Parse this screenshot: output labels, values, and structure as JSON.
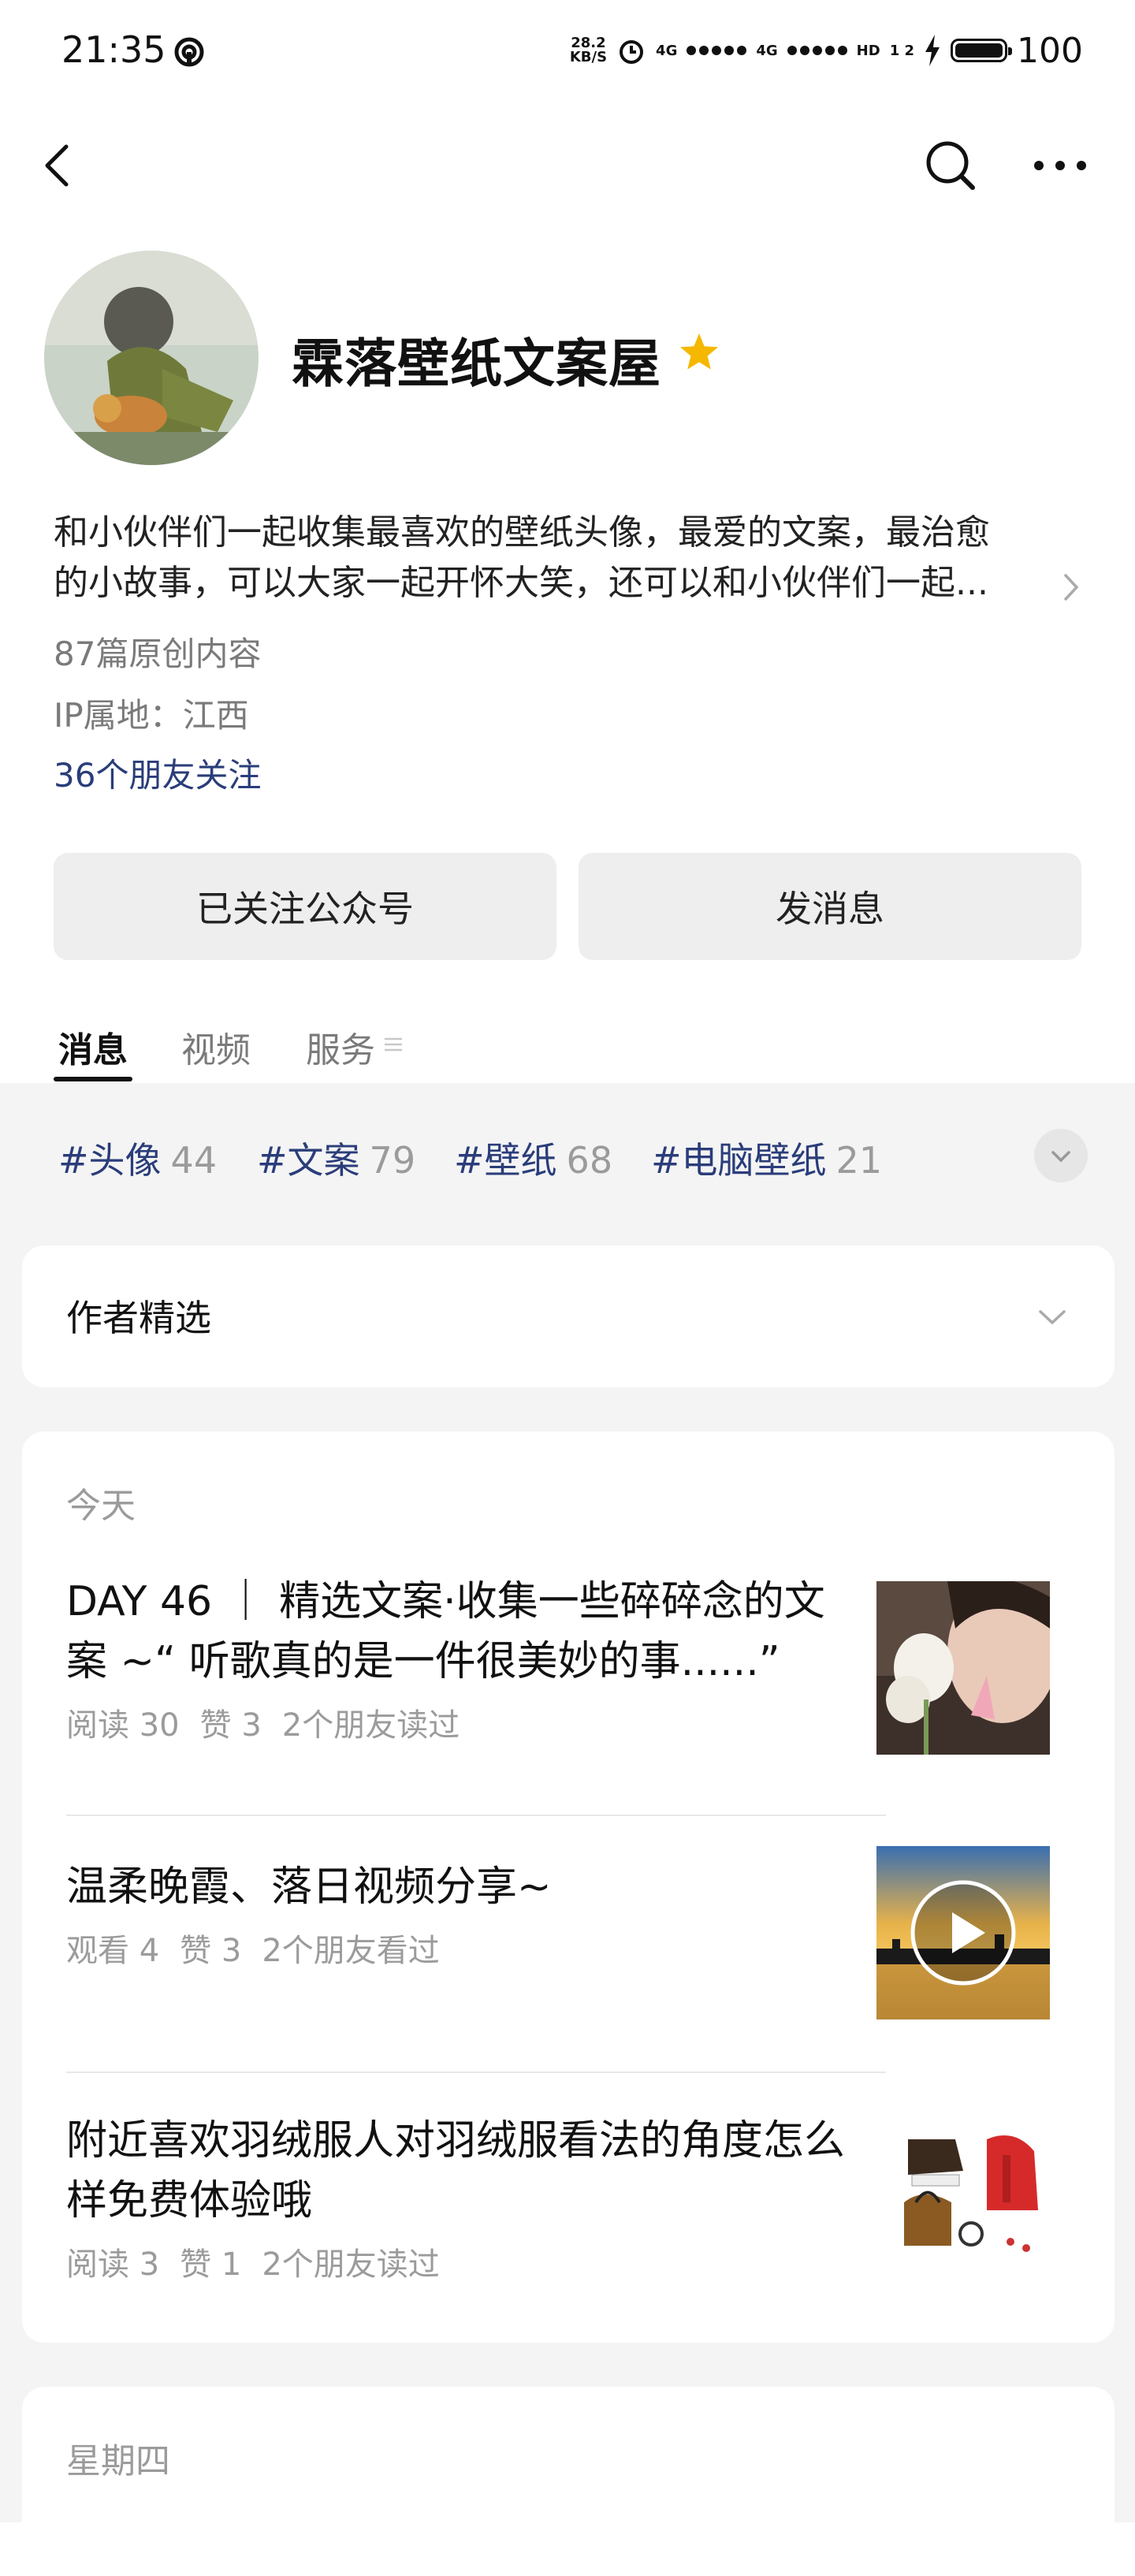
{
  "status_bar": {
    "time": "21:35",
    "net_speed_value": "28.2",
    "net_speed_unit": "KB/S",
    "signal1_label": "4G",
    "signal2_label": "4G",
    "hd_label": "HD",
    "sim_label": "1 2",
    "battery": "100",
    "icons": [
      "hotspot-icon",
      "alarm-icon",
      "signal-icon",
      "charging-icon",
      "battery-icon"
    ]
  },
  "nav": {
    "icons": [
      "back-arrow-icon",
      "search-icon",
      "more-icon"
    ]
  },
  "profile": {
    "name": "霖落壁纸文案屋",
    "verified_color": "#f5b800",
    "description_line1": "和小伙伴们一起收集最喜欢的壁纸头像，最爱的文案，最治愈",
    "description_line2": "的小故事，可以大家一起开怀大笑，还可以和小伙伴们一起...",
    "original_count": "87篇原创内容",
    "ip_location": "IP属地：江西",
    "friends_following": "36个朋友关注"
  },
  "actions": {
    "followed_label": "已关注公众号",
    "message_label": "发消息"
  },
  "tabs": [
    {
      "label": "消息",
      "active": true
    },
    {
      "label": "视频",
      "active": false
    },
    {
      "label": "服务",
      "active": false
    }
  ],
  "tags": [
    {
      "label": "#头像",
      "count": "44"
    },
    {
      "label": "#文案",
      "count": "79"
    },
    {
      "label": "#壁纸",
      "count": "68"
    },
    {
      "label": "#电脑壁纸",
      "count": "21"
    }
  ],
  "featured": {
    "title": "作者精选"
  },
  "today": {
    "label": "今天",
    "articles": [
      {
        "title": "DAY 46 ｜ 精选文案·收集一些碎碎念的文案 ~“ 听歌真的是一件很美妙的事......”",
        "stat1": "阅读 30",
        "stat2": "赞 3",
        "stat3": "2个朋友读过"
      },
      {
        "title": "温柔晚霞、落日视频分享~",
        "stat1": "观看 4",
        "stat2": "赞 3",
        "stat3": "2个朋友看过"
      },
      {
        "title": "附近喜欢羽绒服人对羽绒服看法的角度怎么样免费体验哦",
        "stat1": "阅读 3",
        "stat2": "赞 1",
        "stat3": "2个朋友读过"
      }
    ]
  },
  "thursday": {
    "label": "星期四"
  }
}
